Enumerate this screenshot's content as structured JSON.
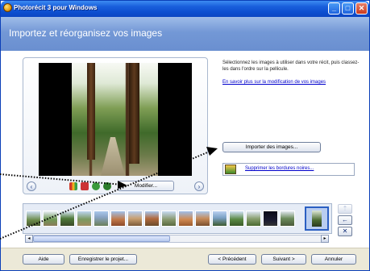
{
  "window": {
    "title": "Photorécit 3 pour Windows"
  },
  "header": {
    "title": "Importez et réorganisez vos images"
  },
  "preview": {
    "prev_arrow": "‹",
    "next_arrow": "›",
    "edit_label": "Modifier..."
  },
  "instructions": {
    "text": "Sélectionnez les images à utiliser dans votre récit, puis classez-les dans l'ordre sur la pellicule.",
    "learn_more": "En savoir plus sur la modification de vos images"
  },
  "actions": {
    "import_label": "Importer des images...",
    "remove_borders_label": "Supprimer les bordures noires..."
  },
  "filmstrip": {
    "side_up": "⇡",
    "side_left": "←",
    "side_remove": "✕",
    "scroll_left": "◂",
    "scroll_right": "▸"
  },
  "footer": {
    "help": "Aide",
    "save": "Enregistrer le projet...",
    "back": "< Précédent",
    "next": "Suivant >",
    "cancel": "Annuler"
  },
  "colors": {
    "title_bar": "#0d4fd0",
    "banner": "#7398d6",
    "selection": "#2b5fc2",
    "link": "#0000cc"
  }
}
